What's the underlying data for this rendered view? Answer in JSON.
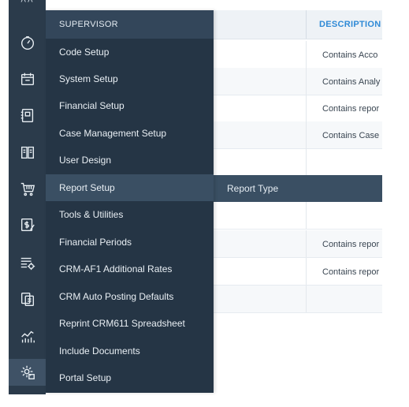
{
  "menu": {
    "header": "SUPERVISOR",
    "items": [
      {
        "label": "Code Setup"
      },
      {
        "label": "System Setup"
      },
      {
        "label": "Financial Setup"
      },
      {
        "label": "Case Management Setup"
      },
      {
        "label": "User Design"
      },
      {
        "label": "Report Setup",
        "active": true
      },
      {
        "label": "Tools & Utilities"
      },
      {
        "label": "Financial Periods"
      },
      {
        "label": "CRM-AF1 Additional Rates"
      },
      {
        "label": "CRM Auto Posting Defaults"
      },
      {
        "label": "Reprint CRM611 Spreadsheet"
      },
      {
        "label": "Include Documents"
      },
      {
        "label": "Portal Setup"
      }
    ]
  },
  "submenu": {
    "item": "Report Type"
  },
  "table": {
    "description_header": "DESCRIPTION",
    "descriptions": [
      "Contains Acco",
      "Contains Analy",
      "Contains repor",
      "Contains Case",
      "",
      "",
      "",
      "Contains repor",
      "Contains repor",
      ""
    ]
  },
  "sidebar": {
    "top_partial": "˄˄",
    "icons": [
      "dashboard-gauge-icon",
      "calendar-icon",
      "notebook-icon",
      "library-icon",
      "shopping-cart-icon",
      "billing-edit-icon",
      "list-settings-icon",
      "copy-documents-icon",
      "analytics-chart-icon",
      "supervisor-settings-icon"
    ],
    "active_icon": "supervisor-settings-icon"
  },
  "colors": {
    "sidebar_bg": "#2b3b4b",
    "menu_bg": "#253545",
    "menu_active": "#3a4f63",
    "header_accent": "#2f8ad6"
  }
}
